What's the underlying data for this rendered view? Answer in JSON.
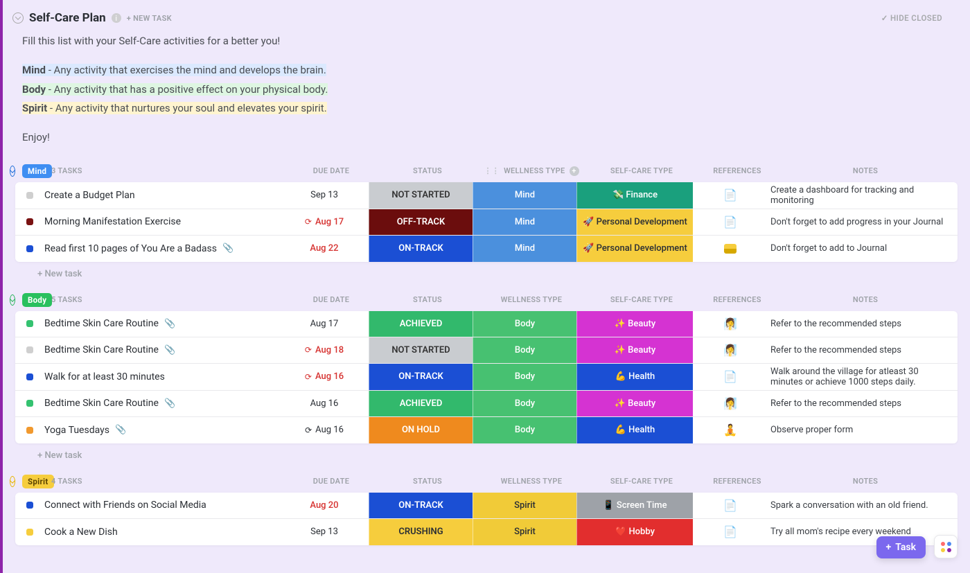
{
  "header": {
    "title": "Self-Care Plan",
    "new_task_top": "+ NEW TASK",
    "hide_closed": "HIDE CLOSED"
  },
  "intro": {
    "line1": "Fill this list with your Self-Care activities for a better you!",
    "mind_label": "Mind",
    "mind_desc": " - Any activity that exercises the mind and develops the brain.",
    "body_label": "Body",
    "body_desc": " - Any activity that has a positive effect on your physical body.",
    "spirit_label": "Spirit",
    "spirit_desc": " - Any activity that nurtures your soul and elevates your spirit.",
    "enjoy": "Enjoy!"
  },
  "columns": {
    "due": "DUE DATE",
    "status": "STATUS",
    "wtype": "WELLNESS TYPE",
    "ctype": "SELF-CARE TYPE",
    "ref": "REFERENCES",
    "notes": "NOTES"
  },
  "newrow": "+ New task",
  "groups": [
    {
      "key": "mind",
      "label": "Mind",
      "count": "3 TASKS",
      "chev": "blue",
      "rows": [
        {
          "bullet": "b-gray",
          "name": "Create a Budget Plan",
          "clip": false,
          "due": "Sep 13",
          "due_red": false,
          "recur": false,
          "status_label": "NOT STARTED",
          "status_cls": "st-notstarted",
          "wt_label": "Mind",
          "wt_cls": "wt-mind",
          "ct_label": "💸 Finance",
          "ct_cls": "ct-finance",
          "ref": "doc",
          "notes": "Create a dashboard for tracking and monitoring"
        },
        {
          "bullet": "b-dkred",
          "name": "Morning Manifestation Exercise",
          "clip": false,
          "due": "Aug 17",
          "due_red": true,
          "recur": true,
          "status_label": "OFF-TRACK",
          "status_cls": "st-offtrack",
          "wt_label": "Mind",
          "wt_cls": "wt-mind",
          "ct_label": "🚀 Personal Development",
          "ct_cls": "ct-pdev",
          "ref": "doc",
          "notes": "Don't forget to add progress in your Journal"
        },
        {
          "bullet": "b-blue",
          "name": "Read first 10 pages of You Are a Badass",
          "clip": true,
          "due": "Aug 22",
          "due_red": true,
          "recur": false,
          "status_label": "ON-TRACK",
          "status_cls": "st-ontrack",
          "wt_label": "Mind",
          "wt_cls": "wt-mind",
          "ct_label": "🚀 Personal Development",
          "ct_cls": "ct-pdev",
          "ref": "card",
          "notes": "Don't forget to add to Journal"
        }
      ]
    },
    {
      "key": "body",
      "label": "Body",
      "count": "5 TASKS",
      "chev": "green",
      "rows": [
        {
          "bullet": "b-green",
          "name": "Bedtime Skin Care Routine",
          "clip": true,
          "due": "Aug 17",
          "due_red": false,
          "recur": false,
          "status_label": "ACHIEVED",
          "status_cls": "st-achieved",
          "wt_label": "Body",
          "wt_cls": "wt-body",
          "ct_label": "✨ Beauty",
          "ct_cls": "ct-beauty",
          "ref": "emoji",
          "ref_emoji": "🧖‍♀️",
          "notes": "Refer to the recommended steps"
        },
        {
          "bullet": "b-gray",
          "name": "Bedtime Skin Care Routine",
          "clip": true,
          "due": "Aug 18",
          "due_red": true,
          "recur": true,
          "status_label": "NOT STARTED",
          "status_cls": "st-notstarted",
          "wt_label": "Body",
          "wt_cls": "wt-body",
          "ct_label": "✨ Beauty",
          "ct_cls": "ct-beauty",
          "ref": "emoji",
          "ref_emoji": "🧖‍♀️",
          "notes": "Refer to the recommended steps"
        },
        {
          "bullet": "b-blue",
          "name": "Walk for at least 30 minutes",
          "clip": false,
          "due": "Aug 16",
          "due_red": true,
          "recur": true,
          "status_label": "ON-TRACK",
          "status_cls": "st-ontrack",
          "wt_label": "Body",
          "wt_cls": "wt-body",
          "ct_label": "💪 Health",
          "ct_cls": "ct-health",
          "ref": "doc",
          "notes": "Walk around the village for atleast 30 minutes or achieve 1000 steps daily."
        },
        {
          "bullet": "b-green",
          "name": "Bedtime Skin Care Routine",
          "clip": true,
          "due": "Aug 16",
          "due_red": false,
          "recur": false,
          "status_label": "ACHIEVED",
          "status_cls": "st-achieved",
          "wt_label": "Body",
          "wt_cls": "wt-body",
          "ct_label": "✨ Beauty",
          "ct_cls": "ct-beauty",
          "ref": "emoji",
          "ref_emoji": "🧖‍♀️",
          "notes": "Refer to the recommended steps"
        },
        {
          "bullet": "b-orange",
          "name": "Yoga Tuesdays",
          "clip": true,
          "due": "Aug 16",
          "due_red": false,
          "recur": true,
          "status_label": "ON HOLD",
          "status_cls": "st-onhold",
          "wt_label": "Body",
          "wt_cls": "wt-body",
          "ct_label": "💪 Health",
          "ct_cls": "ct-health",
          "ref": "emoji",
          "ref_emoji": "🧘",
          "notes": "Observe proper form"
        }
      ]
    },
    {
      "key": "spirit",
      "label": "Spirit",
      "count": "4 TASKS",
      "chev": "yellow",
      "rows": [
        {
          "bullet": "b-blue",
          "name": "Connect with Friends on Social Media",
          "clip": false,
          "due": "Aug 20",
          "due_red": true,
          "recur": false,
          "status_label": "ON-TRACK",
          "status_cls": "st-ontrack",
          "wt_label": "Spirit",
          "wt_cls": "wt-spirit",
          "ct_label": "📱 Screen Time",
          "ct_cls": "ct-screen",
          "ref": "doc",
          "notes": "Spark a conversation with an old friend."
        },
        {
          "bullet": "b-yellow",
          "name": "Cook a New Dish",
          "clip": false,
          "due": "Sep 13",
          "due_red": false,
          "recur": false,
          "status_label": "CRUSHING",
          "status_cls": "st-crushing",
          "wt_label": "Spirit",
          "wt_cls": "wt-spirit",
          "ct_label": "❤️ Hobby",
          "ct_cls": "ct-hobby",
          "ref": "doc",
          "notes": "Try all mom's recipe every weekend"
        }
      ]
    }
  ],
  "float": {
    "task_btn": "Task"
  }
}
